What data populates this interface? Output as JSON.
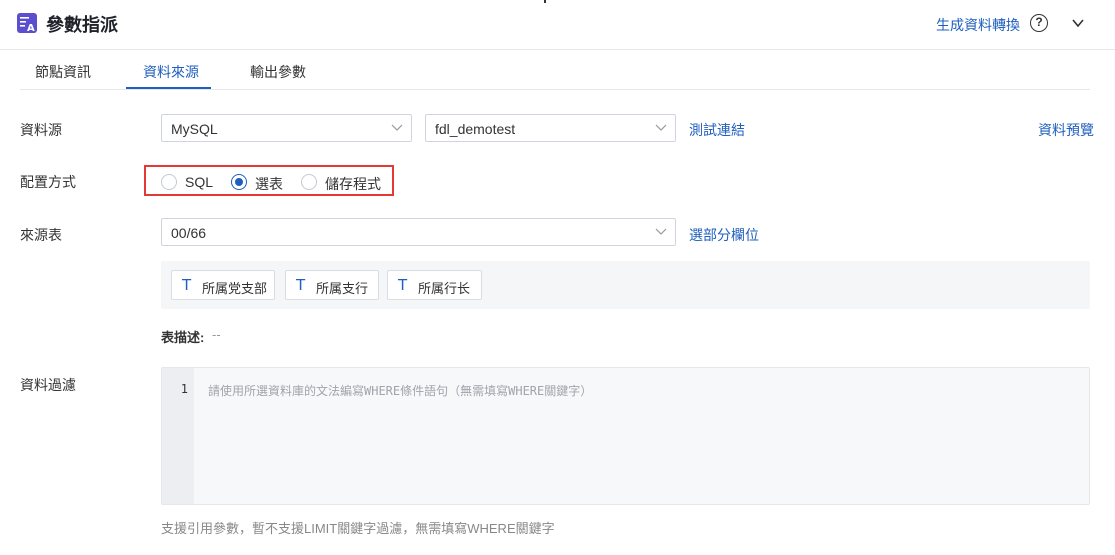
{
  "header": {
    "title": "參數指派",
    "generate_link": "生成資料轉換",
    "help_glyph": "?"
  },
  "tabs": [
    {
      "label": "節點資訊",
      "active": false
    },
    {
      "label": "資料來源",
      "active": true
    },
    {
      "label": "輸出參數",
      "active": false
    }
  ],
  "datasource": {
    "label": "資料源",
    "db_type": "MySQL",
    "connection": "fdl_demotest",
    "test_link": "測試連結",
    "preview_link": "資料預覽"
  },
  "config": {
    "label": "配置方式",
    "options": [
      {
        "label": "SQL",
        "checked": false
      },
      {
        "label": "選表",
        "checked": true
      },
      {
        "label": "儲存程式",
        "checked": false
      }
    ]
  },
  "source_table": {
    "label": "來源表",
    "value": "00/66",
    "select_fields_link": "選部分欄位",
    "fields": [
      "所属党支部",
      "所属支行",
      "所属行长"
    ],
    "field_icon": "T",
    "desc_label": "表描述:",
    "desc_value": "--"
  },
  "filter": {
    "label": "資料過濾",
    "line_number": "1",
    "placeholder": "請使用所選資料庫的文法編寫WHERE條件語句（無需填寫WHERE關鍵字）",
    "hint": "支援引用參數，暫不支援LIMIT關鍵字過濾，無需填寫WHERE關鍵字"
  },
  "colors": {
    "accent": "#1f5fbf",
    "highlight_border": "#e53935"
  }
}
